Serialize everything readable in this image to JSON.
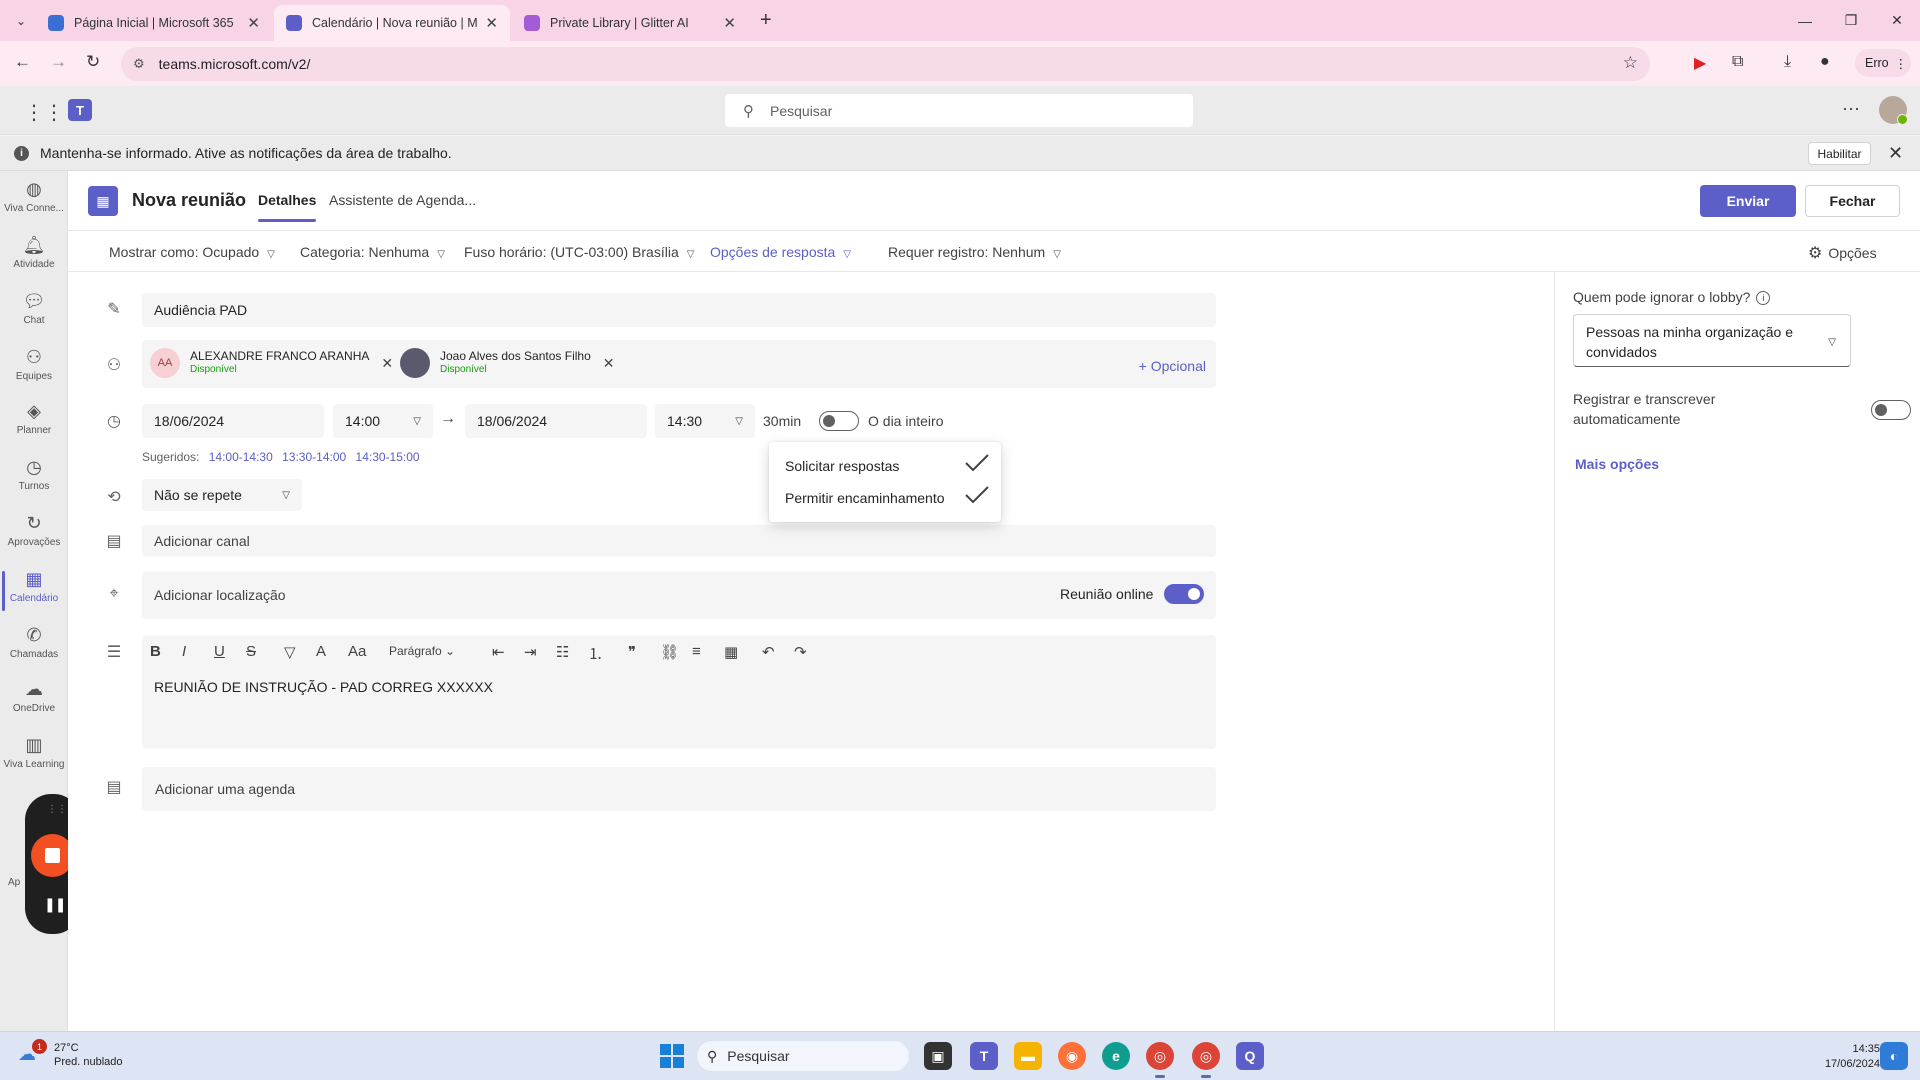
{
  "browser": {
    "tabs": [
      {
        "title": "Página Inicial | Microsoft 365",
        "active": false,
        "favicon_color": "#3b6fd4"
      },
      {
        "title": "Calendário | Nova reunião | Mic",
        "active": true,
        "favicon_color": "#5b5fc7"
      },
      {
        "title": "Private Library | Glitter AI",
        "active": false,
        "favicon_color": "#a35bd6"
      }
    ],
    "url": "teams.microsoft.com/v2/",
    "profile_label": "Erro"
  },
  "teams": {
    "search_placeholder": "Pesquisar",
    "notification": {
      "text": "Mantenha-se informado. Ative as notificações da área de trabalho.",
      "enable_label": "Habilitar"
    }
  },
  "rail": {
    "items": [
      {
        "label": "Viva Conne...",
        "icon": "viva-connections-icon",
        "glyph": "◍"
      },
      {
        "label": "Atividade",
        "icon": "bell-icon",
        "glyph": "🔔︎"
      },
      {
        "label": "Chat",
        "icon": "chat-icon",
        "glyph": "💬︎"
      },
      {
        "label": "Equipes",
        "icon": "teams-group-icon",
        "glyph": "⚇"
      },
      {
        "label": "Planner",
        "icon": "planner-icon",
        "glyph": "◈"
      },
      {
        "label": "Turnos",
        "icon": "shifts-icon",
        "glyph": "◷"
      },
      {
        "label": "Aprovações",
        "icon": "approvals-icon",
        "glyph": "↻"
      },
      {
        "label": "Calendário",
        "icon": "calendar-icon",
        "glyph": "▦"
      },
      {
        "label": "Chamadas",
        "icon": "phone-icon",
        "glyph": "✆"
      },
      {
        "label": "OneDrive",
        "icon": "cloud-icon",
        "glyph": "☁"
      },
      {
        "label": "Viva Learning",
        "icon": "learning-icon",
        "glyph": "▥"
      }
    ],
    "partial_label": "Ap"
  },
  "meeting": {
    "header_title": "Nova reunião",
    "tab_details": "Detalhes",
    "tab_assistant": "Assistente de Agenda...",
    "send_label": "Enviar",
    "close_label": "Fechar",
    "options": {
      "show_as": "Mostrar como: Ocupado",
      "category": "Categoria: Nenhuma",
      "timezone": "Fuso horário: (UTC-03:00) Brasília",
      "response_options": "Opções de resposta",
      "registration": "Requer registro: Nenhum",
      "settings": "Opções"
    },
    "title_value": "Audiência PAD",
    "attendees": [
      {
        "initials": "AA",
        "name": "ALEXANDRE FRANCO ARANHA",
        "status": "Disponível"
      },
      {
        "initials": "",
        "name": "Joao Alves dos Santos Filho",
        "status": "Disponível"
      }
    ],
    "optional_label": "+ Opcional",
    "start_date": "18/06/2024",
    "start_time": "14:00",
    "end_date": "18/06/2024",
    "end_time": "14:30",
    "duration": "30min",
    "all_day_label": "O dia inteiro",
    "all_day": false,
    "suggested_label": "Sugeridos:",
    "suggested_slots": [
      "14:00-14:30",
      "13:30-14:00",
      "14:30-15:00"
    ],
    "repeat": "Não se repete",
    "channel_placeholder": "Adicionar canal",
    "location_placeholder": "Adicionar localização",
    "online_label": "Reunião online",
    "online": true,
    "paragraph_label": "Parágrafo",
    "body_text": "REUNIÃO DE INSTRUÇÃO - PAD CORREG XXXXXX",
    "agenda_placeholder": "Adicionar uma agenda"
  },
  "response_dropdown": {
    "items": [
      {
        "label": "Solicitar respostas",
        "checked": true
      },
      {
        "label": "Permitir encaminhamento",
        "checked": true
      }
    ]
  },
  "right_pane": {
    "lobby_label": "Quem pode ignorar o lobby?",
    "lobby_value": "Pessoas na minha organização e convidados",
    "record_label": "Registrar e transcrever automaticamente",
    "record_on": false,
    "more_options": "Mais opções"
  },
  "taskbar": {
    "weather_temp": "27°C",
    "weather_desc": "Pred. nublado",
    "weather_badge": "1",
    "search_placeholder": "Pesquisar",
    "time": "14:35",
    "date": "17/06/2024"
  },
  "colors": {
    "accent": "#5b5fc7",
    "tab_bar": "#f7d4e6",
    "recorder_stop": "#f25022"
  }
}
